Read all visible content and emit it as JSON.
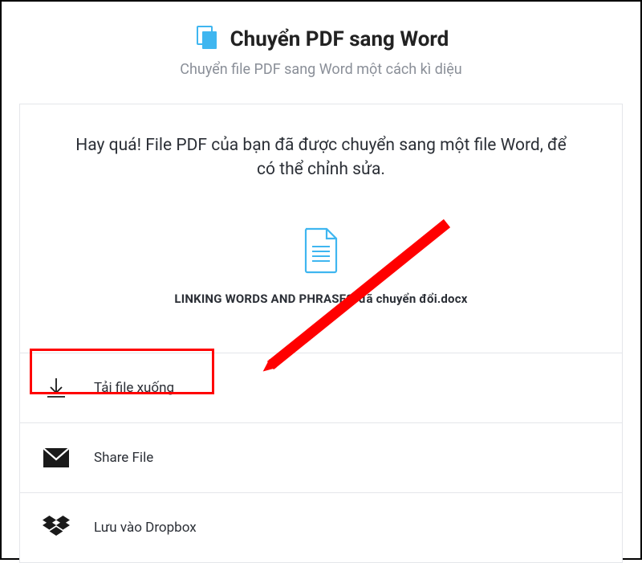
{
  "header": {
    "title": "Chuyển PDF sang Word",
    "subtitle": "Chuyển file PDF sang Word một cách kì diệu"
  },
  "success_message": "Hay quá! File PDF của bạn đã được chuyển sang một file Word, để có thể chỉnh sửa.",
  "file": {
    "name": "LINKING WORDS AND PHRASES-đã chuyển đổi.docx"
  },
  "actions": {
    "download": "Tải file xuống",
    "share": "Share File",
    "dropbox": "Lưu vào Dropbox"
  },
  "colors": {
    "accent": "#3fb6f0",
    "highlight": "#ff0000"
  }
}
